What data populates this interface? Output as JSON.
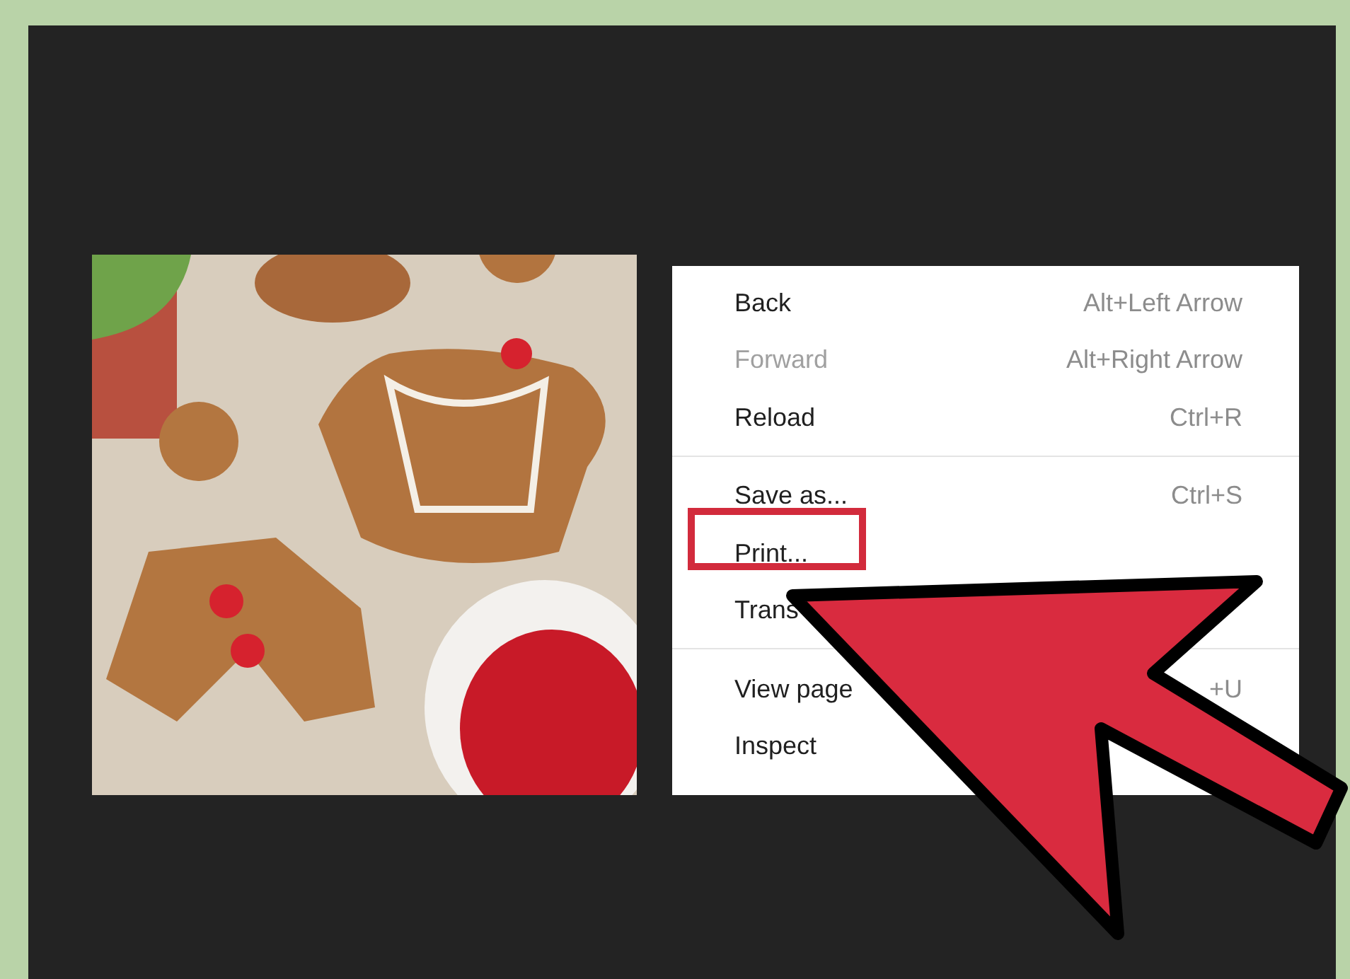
{
  "context_menu": {
    "groups": [
      {
        "items": [
          {
            "label": "Back",
            "shortcut": "Alt+Left Arrow",
            "disabled": false,
            "highlighted": false
          },
          {
            "label": "Forward",
            "shortcut": "Alt+Right Arrow",
            "disabled": true,
            "highlighted": false
          },
          {
            "label": "Reload",
            "shortcut": "Ctrl+R",
            "disabled": false,
            "highlighted": false
          }
        ]
      },
      {
        "items": [
          {
            "label": "Save as...",
            "shortcut": "Ctrl+S",
            "disabled": false,
            "highlighted": false
          },
          {
            "label": "Print...",
            "disabled": false,
            "highlighted": true
          },
          {
            "label": "Trans",
            "disabled": false,
            "highlighted": false
          }
        ]
      },
      {
        "items": [
          {
            "label": "View page",
            "shortcut": "+U",
            "disabled": false,
            "highlighted": false
          },
          {
            "label": "Inspect",
            "disabled": false,
            "highlighted": false
          }
        ]
      }
    ]
  }
}
